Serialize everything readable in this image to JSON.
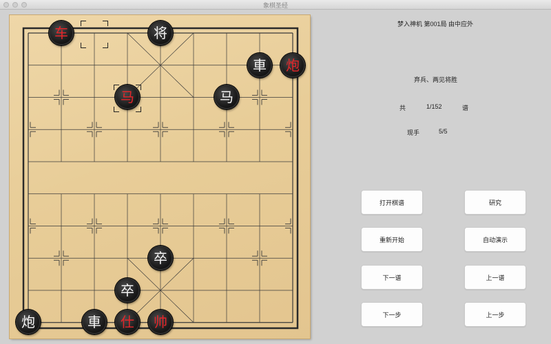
{
  "window": {
    "title": "象棋圣经"
  },
  "game": {
    "title": "梦入神机 第001局 由中应外",
    "comment": "弃兵、两见将胜",
    "total_label": "共",
    "total_value": "1/152",
    "total_unit": "谱",
    "move_label": "现手",
    "move_value": "5/5"
  },
  "pieces": {
    "red_chariot": "车",
    "black_general": "将",
    "black_chariot": "車",
    "red_cannon_top": "炮",
    "red_horse": "马",
    "black_horse": "马",
    "black_soldier_upper": "卒",
    "black_soldier_lower": "卒",
    "black_cannon": "炮",
    "black_chariot_bottom": "車",
    "red_advisor": "仕",
    "red_king": "帅"
  },
  "buttons": {
    "open_manual": "打开棋谱",
    "research": "研究",
    "restart": "重新开始",
    "auto_play": "自动演示",
    "next_manual": "下一谱",
    "prev_manual": "上一谱",
    "next_step": "下一步",
    "prev_step": "上一步"
  },
  "colors": {
    "red_piece_text": "#e3262a",
    "black_piece_text": "#f3f3f3",
    "board_wood": "#e8cd98",
    "board_line": "#3a3a3a"
  }
}
